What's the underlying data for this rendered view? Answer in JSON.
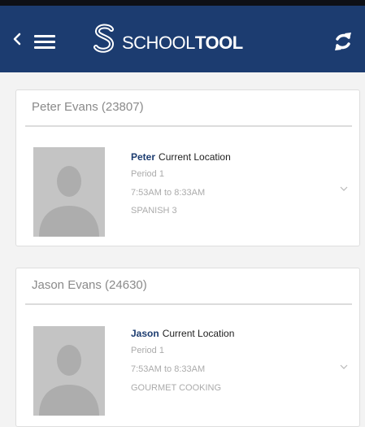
{
  "header": {
    "logo_text_light": "SCHOOL",
    "logo_text_bold": "TOOL",
    "icons": {
      "back": "chevron-left-icon",
      "menu": "hamburger-menu-icon",
      "logo": "schooltool-s-logo-icon",
      "refresh": "refresh-icon"
    }
  },
  "students": [
    {
      "header": "Peter Evans (23807)",
      "first_name": "Peter",
      "location_label": "Current Location",
      "period": "Period 1",
      "time": "7:53AM to 8:33AM",
      "course": "SPANISH 3"
    },
    {
      "header": "Jason Evans (24630)",
      "first_name": "Jason",
      "location_label": "Current Location",
      "period": "Period 1",
      "time": "7:53AM to 8:33AM",
      "course": "GOURMET COOKING"
    }
  ],
  "colors": {
    "appbar": "#1c3c70",
    "name_accent": "#1c3c70",
    "muted_text": "#ababab",
    "photo_bg": "#c4c4c4"
  }
}
